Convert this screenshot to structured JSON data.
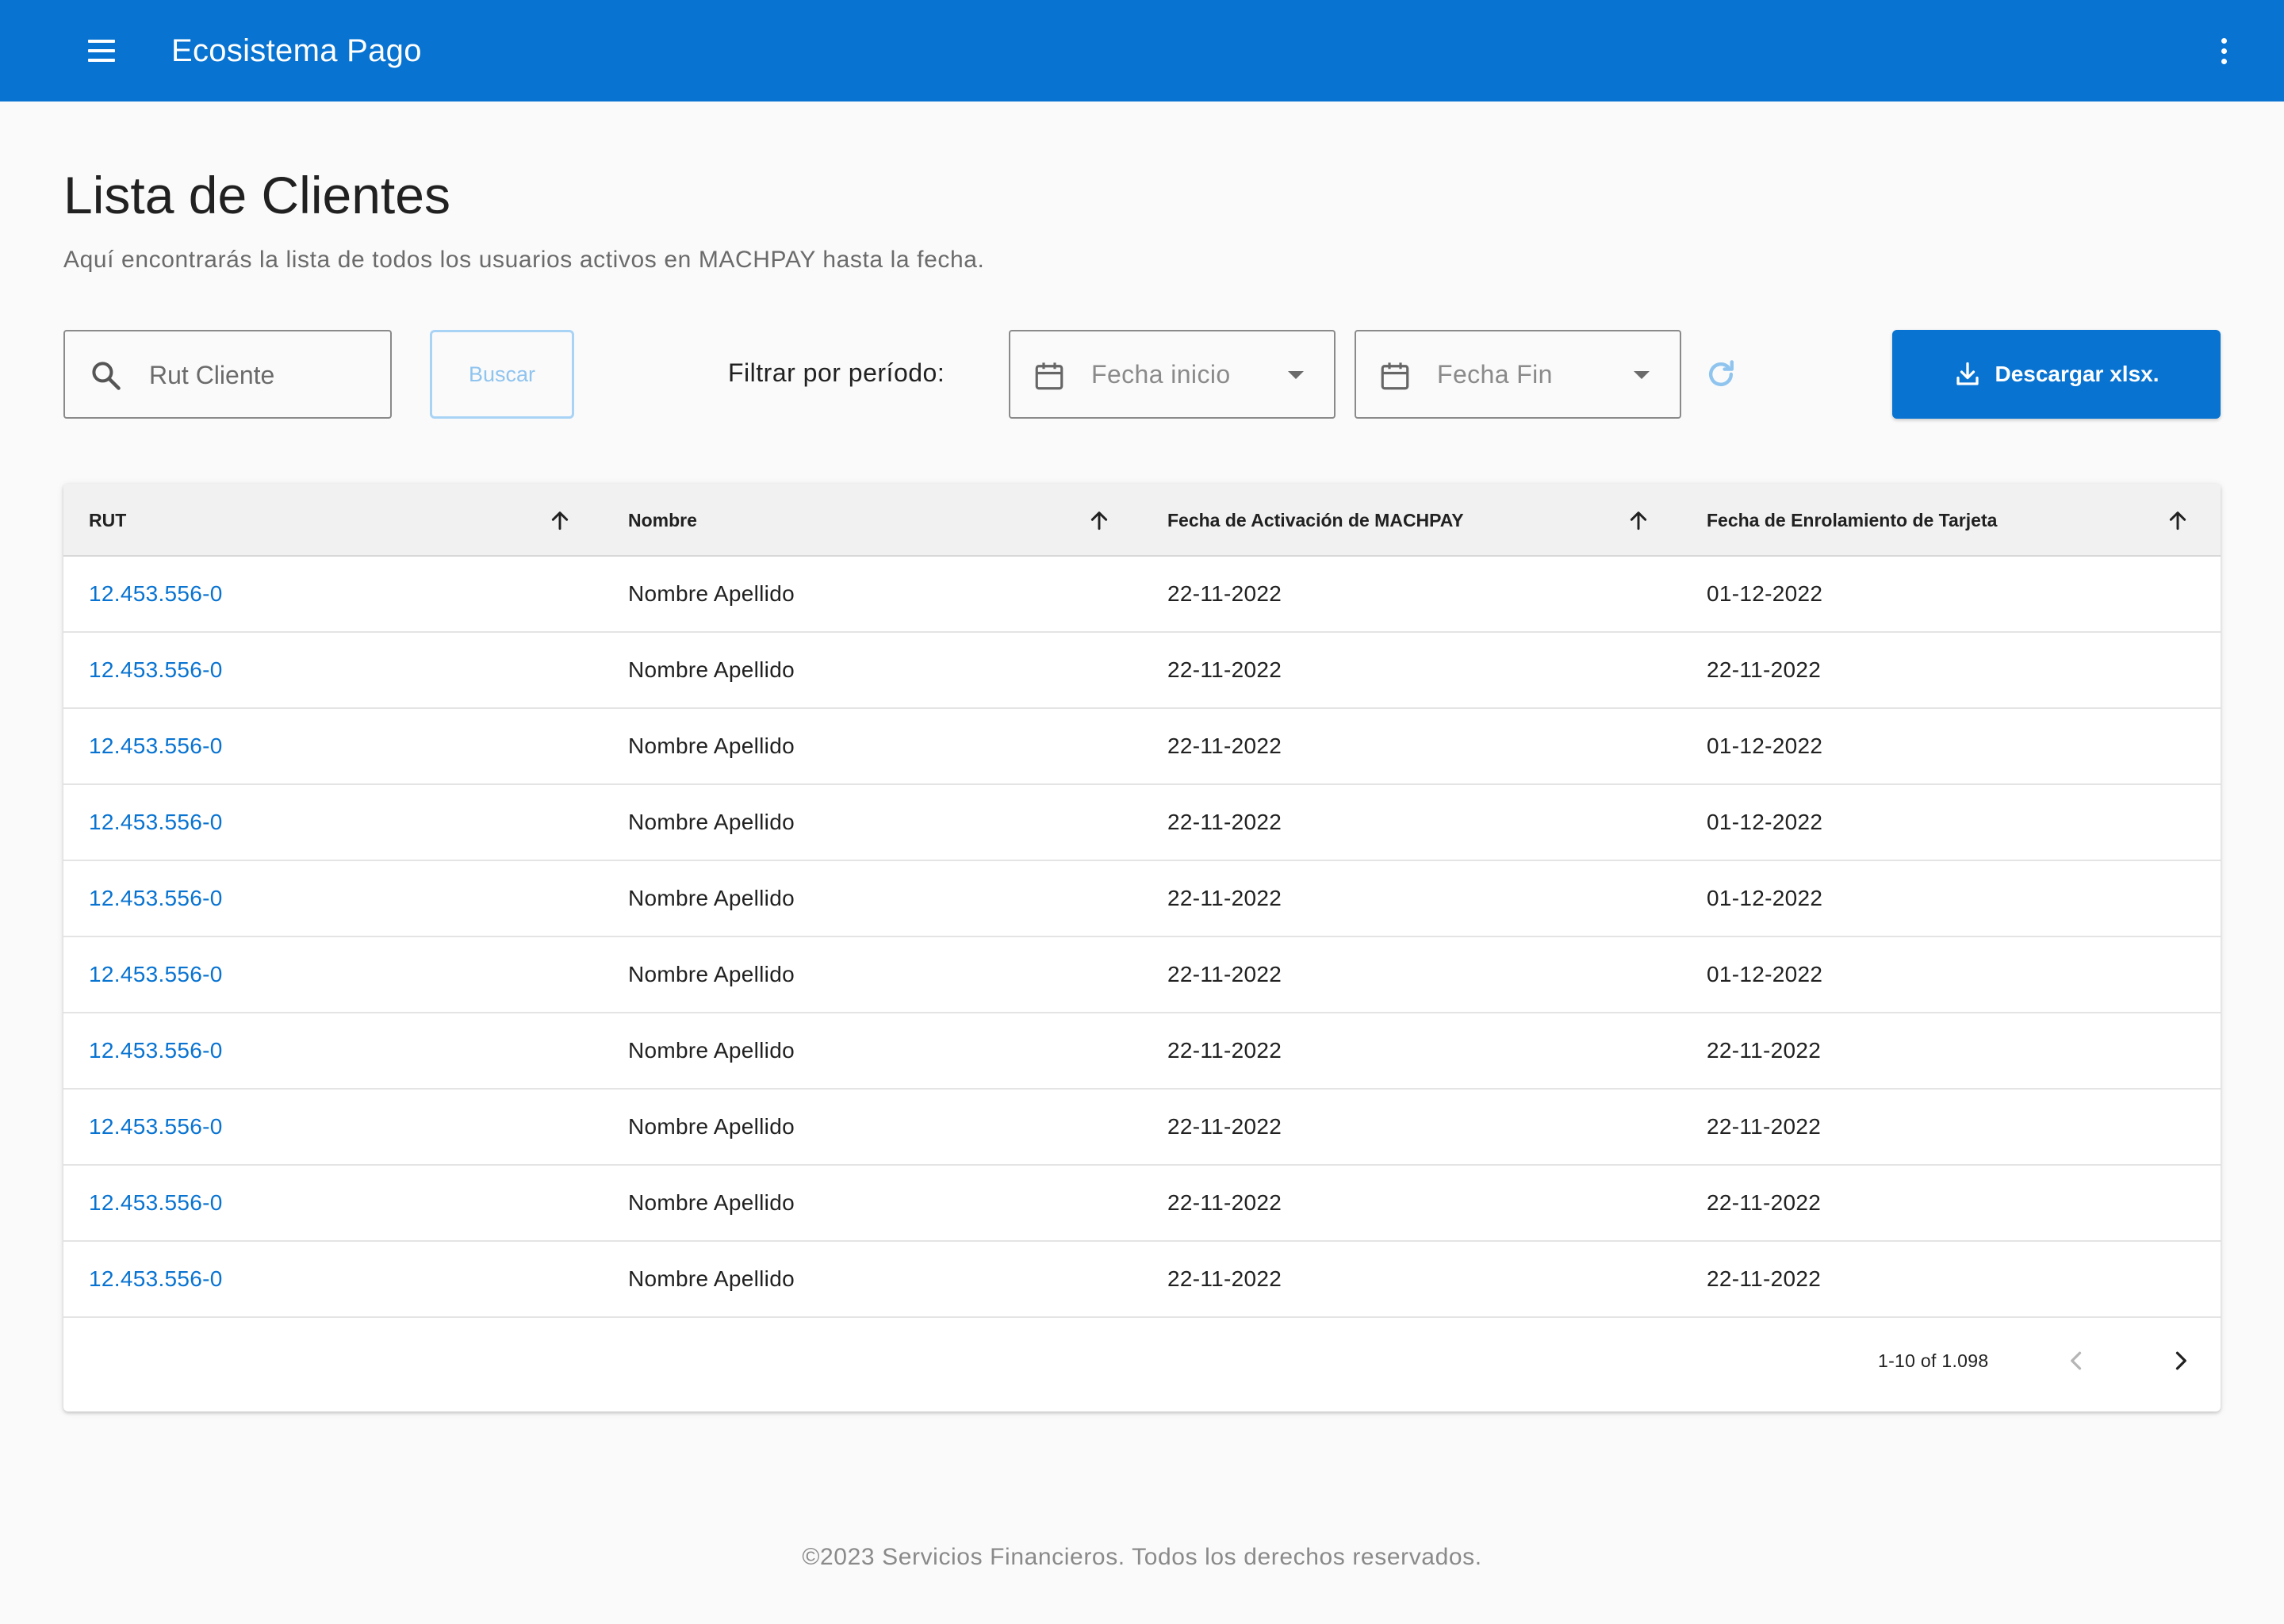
{
  "appbar": {
    "title": "Ecosistema Pago"
  },
  "page": {
    "title": "Lista de Clientes",
    "subtitle": "Aquí encontrarás la lista de todos los usuarios activos en MACHPAY hasta la fecha."
  },
  "toolbar": {
    "search_placeholder": "Rut Cliente",
    "search_value": "",
    "search_button": "Buscar",
    "filter_label": "Filtrar por período:",
    "start_date": "Fecha inicio",
    "end_date": "Fecha Fin",
    "download_button": "Descargar xlsx."
  },
  "table": {
    "columns": [
      "RUT",
      "Nombre",
      "Fecha de Activación de MACHPAY",
      "Fecha de Enrolamiento de Tarjeta"
    ],
    "rows": [
      [
        "12.453.556-0",
        "Nombre Apellido",
        "22-11-2022",
        "01-12-2022"
      ],
      [
        "12.453.556-0",
        "Nombre Apellido",
        "22-11-2022",
        "22-11-2022"
      ],
      [
        "12.453.556-0",
        "Nombre Apellido",
        "22-11-2022",
        "01-12-2022"
      ],
      [
        "12.453.556-0",
        "Nombre Apellido",
        "22-11-2022",
        "01-12-2022"
      ],
      [
        "12.453.556-0",
        "Nombre Apellido",
        "22-11-2022",
        "01-12-2022"
      ],
      [
        "12.453.556-0",
        "Nombre Apellido",
        "22-11-2022",
        "01-12-2022"
      ],
      [
        "12.453.556-0",
        "Nombre Apellido",
        "22-11-2022",
        "22-11-2022"
      ],
      [
        "12.453.556-0",
        "Nombre Apellido",
        "22-11-2022",
        "22-11-2022"
      ],
      [
        "12.453.556-0",
        "Nombre Apellido",
        "22-11-2022",
        "22-11-2022"
      ],
      [
        "12.453.556-0",
        "Nombre Apellido",
        "22-11-2022",
        "22-11-2022"
      ]
    ]
  },
  "pagination": {
    "range_text": "1-10 of 1.098"
  },
  "footer": {
    "text": "©2023 Servicios Financieros. Todos los derechos reservados."
  },
  "colors": {
    "primary": "#0873d1",
    "disabled_button": "#a9d3f5",
    "header_bg": "#f1f1f1",
    "page_bg": "#fafafa"
  },
  "icons": {
    "menu": "menu-icon",
    "more": "more-vert-icon",
    "search": "search-icon",
    "calendar": "calendar-icon",
    "dropdown": "arrow-drop-down-icon",
    "refresh": "refresh-icon",
    "download": "download-icon",
    "sort": "arrow-up-icon",
    "prev": "chevron-left-icon",
    "next": "chevron-right-icon"
  }
}
